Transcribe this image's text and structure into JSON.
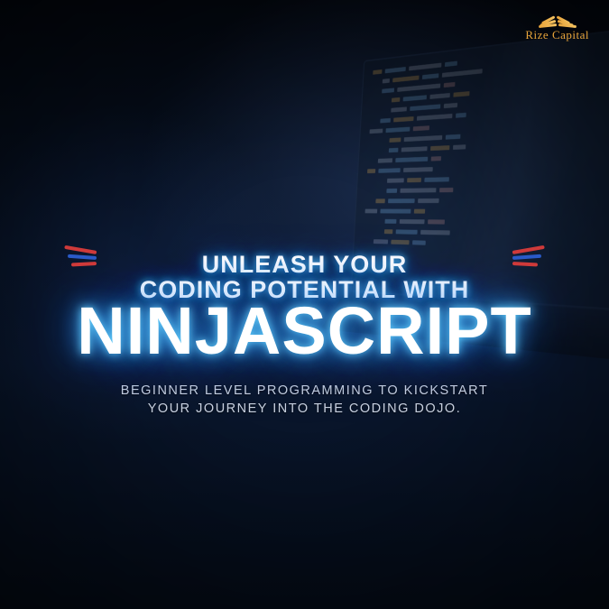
{
  "brand": {
    "name": "Rize Capital",
    "icon": "wings-icon",
    "accent_color": "#e8a43a"
  },
  "hero": {
    "headline_line1": "UNLEASH YOUR",
    "headline_line2": "CODING POTENTIAL WITH",
    "headline_big": "NINJASCRIPT",
    "subhead_line1": "BEGINNER LEVEL PROGRAMMING TO KICKSTART",
    "subhead_line2": "YOUR JOURNEY INTO THE CODING DOJO.",
    "glow_color": "#3aa0ff"
  },
  "background": {
    "description": "dark blue laptop with code editor, blurred office",
    "base_color": "#0a1830"
  }
}
